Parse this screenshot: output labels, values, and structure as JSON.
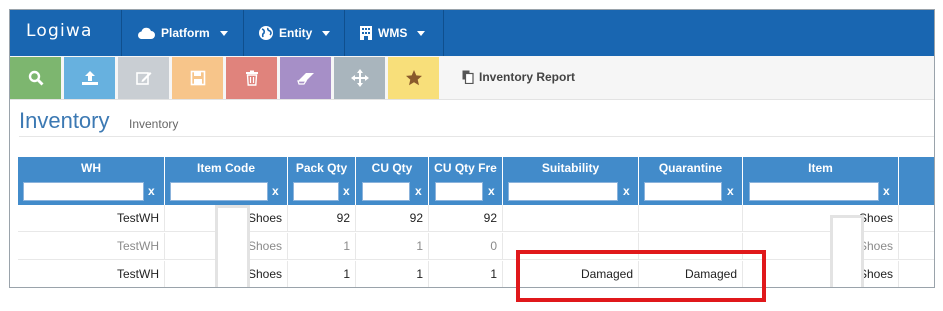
{
  "app": {
    "logo": "Logiwa"
  },
  "nav": [
    {
      "label": "Platform",
      "icon": "cloud-icon"
    },
    {
      "label": "Entity",
      "icon": "globe-icon"
    },
    {
      "label": "WMS",
      "icon": "building-icon"
    }
  ],
  "toolbar": {
    "buttons": [
      {
        "name": "search",
        "icon": "search-icon",
        "color": "#7db66f"
      },
      {
        "name": "upload",
        "icon": "upload-icon",
        "color": "#67b1df"
      },
      {
        "name": "edit",
        "icon": "edit-icon",
        "color": "#c9ced3"
      },
      {
        "name": "save",
        "icon": "save-icon",
        "color": "#f7c58a"
      },
      {
        "name": "delete",
        "icon": "trash-icon",
        "color": "#e0837c"
      },
      {
        "name": "clear",
        "icon": "eraser-icon",
        "color": "#a68fc7"
      },
      {
        "name": "move",
        "icon": "move-icon",
        "color": "#a9b5bd"
      },
      {
        "name": "favorite",
        "icon": "star-icon",
        "color": "#f8df7a"
      }
    ],
    "report_label": "Inventory Report"
  },
  "page": {
    "title": "Inventory",
    "subtitle": "Inventory"
  },
  "grid": {
    "columns": [
      "WH",
      "Item Code",
      "Pack Qty",
      "CU Qty",
      "CU Qty Fre",
      "Suitability",
      "Quarantine",
      "Item"
    ],
    "filter_clear": "x",
    "rows": [
      {
        "wh": "TestWH",
        "item_code": "Shoes",
        "pack_qty": "92",
        "cu_qty": "92",
        "cu_qty_free": "92",
        "suitability": "",
        "quarantine": "",
        "item": "Shoes"
      },
      {
        "wh": "TestWH",
        "item_code": "Shoes",
        "pack_qty": "1",
        "cu_qty": "1",
        "cu_qty_free": "0",
        "suitability": "",
        "quarantine": "",
        "item": "Shoes"
      },
      {
        "wh": "TestWH",
        "item_code": "Shoes",
        "pack_qty": "1",
        "cu_qty": "1",
        "cu_qty_free": "1",
        "suitability": "Damaged",
        "quarantine": "Damaged",
        "item": "Shoes"
      }
    ]
  },
  "colors": {
    "navbar": "#1966b1",
    "grid_header": "#428bca",
    "highlight": "#e0181b",
    "title": "#3c79b3"
  }
}
